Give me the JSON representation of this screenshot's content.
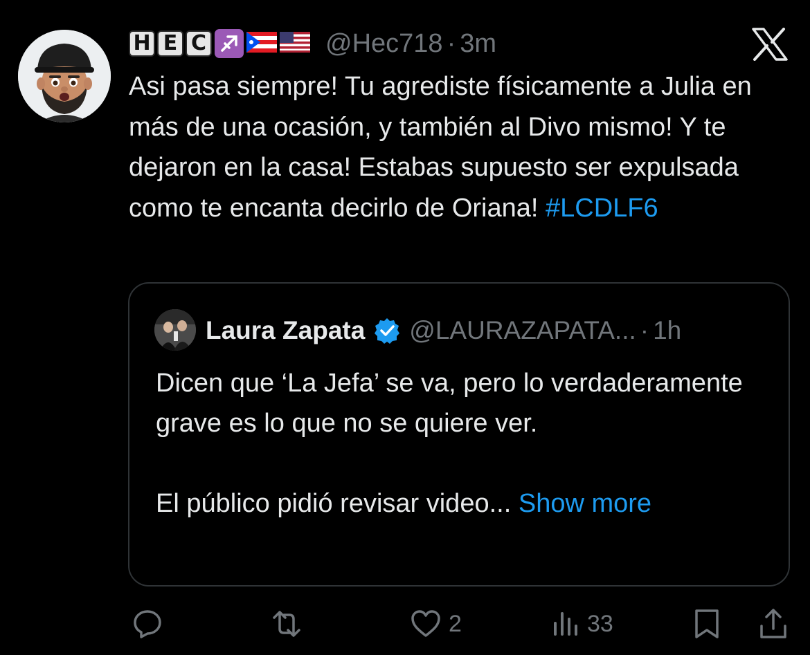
{
  "tweet": {
    "author": {
      "display_name_letters": [
        "H",
        "E",
        "C"
      ],
      "display_name_emoji": [
        "sagittarius-sign-icon",
        "puerto-rico-flag-icon",
        "us-flag-icon"
      ],
      "handle": "@Hec718",
      "separator": "·",
      "time": "3m"
    },
    "text": "Asi pasa siempre! Tu agrediste físicamente a Julia en más de una ocasión, y también al Divo mismo! Y te dejaron en la casa! Estabas supuesto ser expulsada como te encanta decirlo de Oriana!",
    "hashtag": "#LCDLF6",
    "platform_icon": "x-logo-icon"
  },
  "quote": {
    "author_name": "Laura Zapata",
    "verified": true,
    "handle": "@LAURAZAPATA...",
    "separator": "·",
    "time": "1h",
    "paragraph1": "Dicen que ‘La Jefa’ se va, pero lo verdaderamente grave es lo que no se quiere ver.",
    "paragraph2": "El público pidió revisar video",
    "ellipsis": "...",
    "show_more": "Show more"
  },
  "actions": {
    "reply": {
      "icon": "reply-icon",
      "count": ""
    },
    "repost": {
      "icon": "repost-icon",
      "count": ""
    },
    "like": {
      "icon": "heart-icon",
      "count": "2"
    },
    "views": {
      "icon": "views-icon",
      "count": "33"
    },
    "bookmark": {
      "icon": "bookmark-icon",
      "count": ""
    },
    "share": {
      "icon": "share-icon",
      "count": ""
    }
  },
  "colors": {
    "background": "#000000",
    "text": "#e7e9ea",
    "muted": "#71767b",
    "accent": "#1d9bf0",
    "border": "#2f3336"
  }
}
